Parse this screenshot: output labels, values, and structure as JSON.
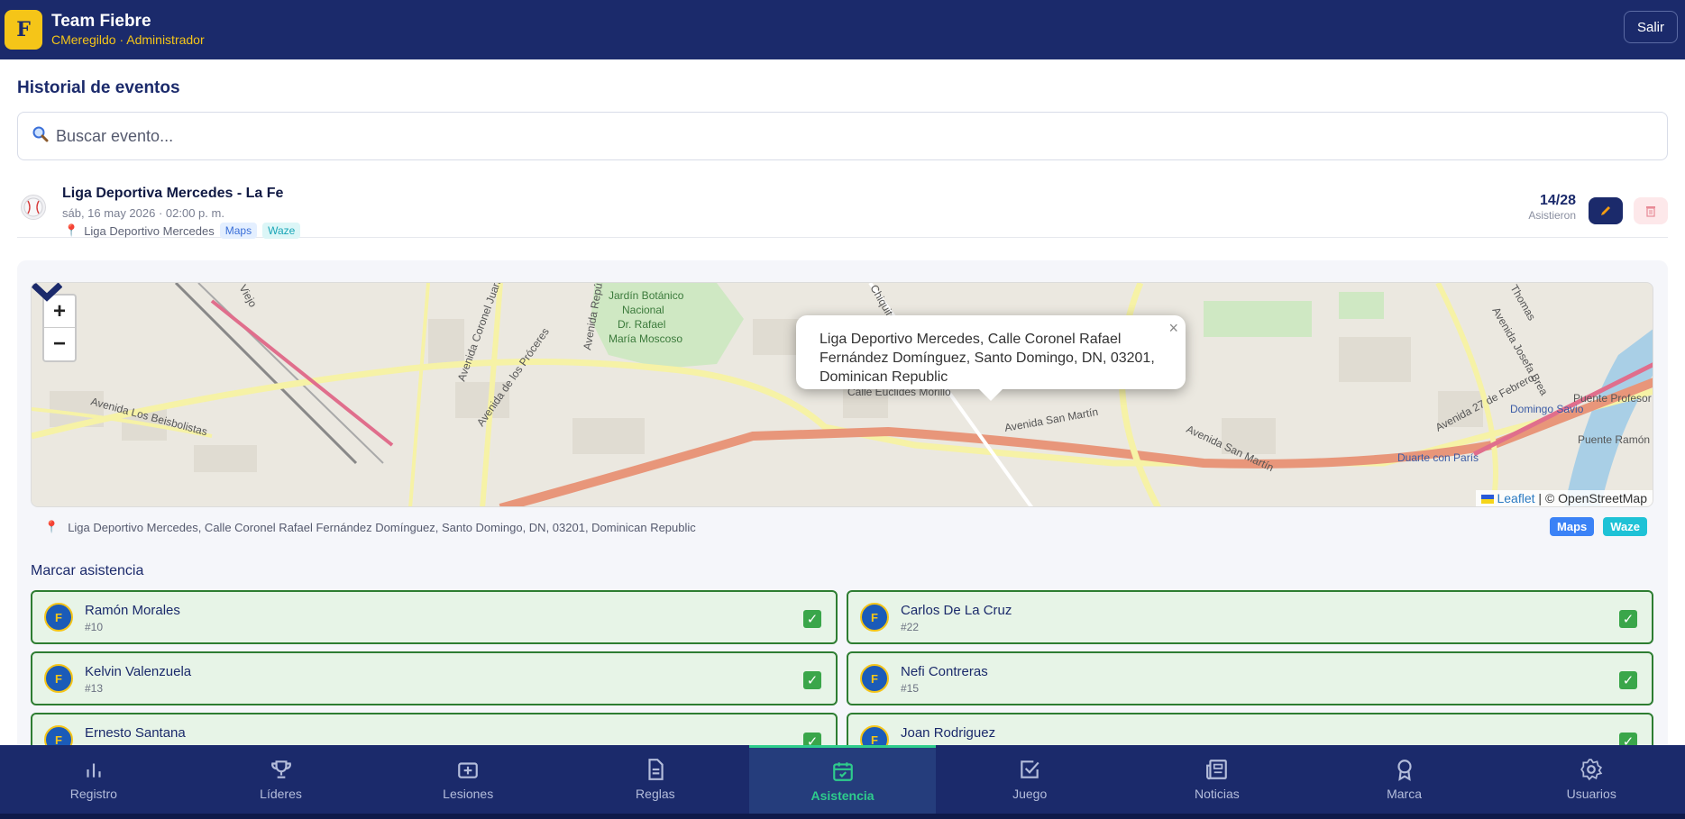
{
  "header": {
    "logo_letter": "F",
    "team_name": "Team Fiebre",
    "user_line": "CMeregildo · Administrador",
    "logout_label": "Salir"
  },
  "page": {
    "title": "Historial de eventos",
    "search_placeholder": "Buscar evento..."
  },
  "event": {
    "title": "Liga Deportiva Mercedes - La Fe",
    "date": "sáb, 16 may 2026 · 02:00 p. m.",
    "location": "Liga Deportivo Mercedes",
    "maps_chip": "Maps",
    "waze_chip": "Waze",
    "attendance_count": "14/28",
    "attendance_label": "Asistieron"
  },
  "map": {
    "popup_text": "Liga Deportivo Mercedes, Calle Coronel Rafael Fernández Domínguez, Santo Domingo, DN, 03201, Dominican Republic",
    "popup_close": "×",
    "zoom_in": "+",
    "zoom_out": "−",
    "attribution_leaflet": "Leaflet",
    "attribution_osm": "| © OpenStreetMap",
    "labels": {
      "jardin1": "Jardín Botánico",
      "jardin2": "Nacional",
      "jardin3": "Dr. Rafael",
      "jardin4": "María Moscoso",
      "proceres": "Avenida de los Próceres",
      "beisbolistas": "Avenida Los Beisbolistas",
      "san_martin": "Avenida San Martín",
      "san_martin2": "Avenida San Martín",
      "euclides": "Calle Euclides Morillo",
      "coronel": "Avenida Coronel Juan María Lora",
      "republica": "Avenida República de Colombia",
      "chiquito": "Chiquito",
      "duarte": "Duarte con París",
      "domingo": "Domingo Savio",
      "puente_profesor": "Puente Profesor Juan Bosch",
      "puente_ramon": "Puente Ramón",
      "febrero": "Avenida 27 de Febrero",
      "josefa": "Avenida Josefa Brea",
      "thomas": "Thomas",
      "viejo": "Viejo"
    }
  },
  "address": {
    "text": "Liga Deportivo Mercedes, Calle Coronel Rafael Fernández Domínguez, Santo Domingo, DN, 03201, Dominican Republic",
    "maps_label": "Maps",
    "waze_label": "Waze"
  },
  "attendance": {
    "title": "Marcar asistencia",
    "players": [
      {
        "name": "Ramón Morales",
        "number": "#10"
      },
      {
        "name": "Carlos De La Cruz",
        "number": "#22"
      },
      {
        "name": "Kelvin Valenzuela",
        "number": "#13"
      },
      {
        "name": "Nefi Contreras",
        "number": "#15"
      },
      {
        "name": "Ernesto Santana",
        "number": ""
      },
      {
        "name": "Joan Rodriguez",
        "number": ""
      }
    ]
  },
  "nav": {
    "items": [
      {
        "label": "Registro"
      },
      {
        "label": "Líderes"
      },
      {
        "label": "Lesiones"
      },
      {
        "label": "Reglas"
      },
      {
        "label": "Asistencia"
      },
      {
        "label": "Juego"
      },
      {
        "label": "Noticias"
      },
      {
        "label": "Marca"
      },
      {
        "label": "Usuarios"
      }
    ]
  },
  "colors": {
    "primary": "#1b2a6b",
    "accent": "#f5c518",
    "active_nav": "#2ecc8c",
    "present_bg": "#e7f4e7",
    "present_border": "#2e7d32"
  }
}
